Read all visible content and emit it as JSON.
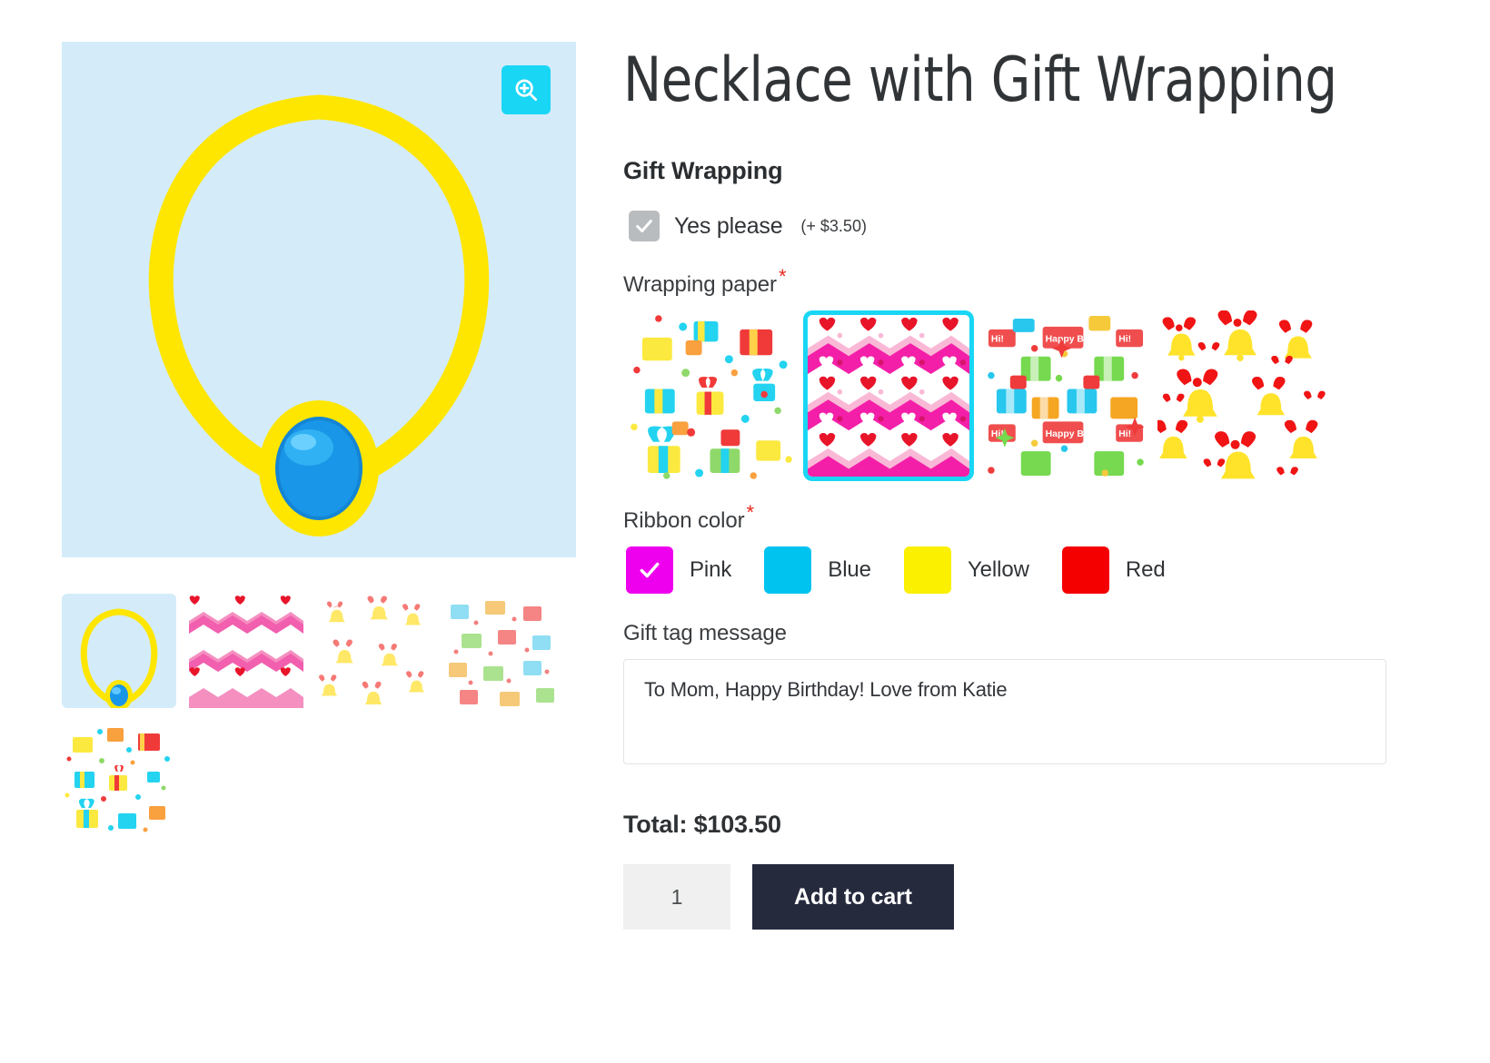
{
  "product": {
    "title": "Necklace with Gift Wrapping",
    "total_label": "Total: $103.50",
    "quantity": "1",
    "add_to_cart_label": "Add to cart"
  },
  "gallery": {
    "zoom_icon": "magnifier-plus-icon",
    "main_image_alt": "Yellow necklace with blue gemstone pendant",
    "thumbnails": [
      {
        "name": "necklace",
        "active": true
      },
      {
        "name": "pink-hearts-chevron-paper",
        "active": false
      },
      {
        "name": "bells-and-bows-paper",
        "active": false
      },
      {
        "name": "happy-birthday-paper",
        "active": false
      },
      {
        "name": "gift-boxes-confetti-paper",
        "active": false
      }
    ]
  },
  "gift_wrapping": {
    "heading": "Gift Wrapping",
    "checkbox": {
      "label": "Yes please",
      "price": "(+ $3.50)",
      "checked": true
    },
    "wrapping_paper": {
      "label": "Wrapping paper",
      "required_marker": "*",
      "options": [
        {
          "name": "gift-boxes-confetti",
          "selected": false
        },
        {
          "name": "pink-hearts-chevron",
          "selected": true
        },
        {
          "name": "happy-birthday",
          "selected": false
        },
        {
          "name": "bells-and-bows",
          "selected": false
        }
      ]
    },
    "ribbon_color": {
      "label": "Ribbon color",
      "required_marker": "*",
      "options": [
        {
          "name": "Pink",
          "hex": "#ee00ee",
          "selected": true
        },
        {
          "name": "Blue",
          "hex": "#00c3f0",
          "selected": false
        },
        {
          "name": "Yellow",
          "hex": "#fbf000",
          "selected": false
        },
        {
          "name": "Red",
          "hex": "#f40000",
          "selected": false
        }
      ]
    },
    "gift_tag": {
      "label": "Gift tag message",
      "value": "To Mom, Happy Birthday! Love from Katie",
      "placeholder": ""
    }
  },
  "colors": {
    "accent_cyan": "#19d6f5",
    "image_bg": "#d4ecf9",
    "button_dark": "#262a3d",
    "required_red": "#e8271b"
  }
}
